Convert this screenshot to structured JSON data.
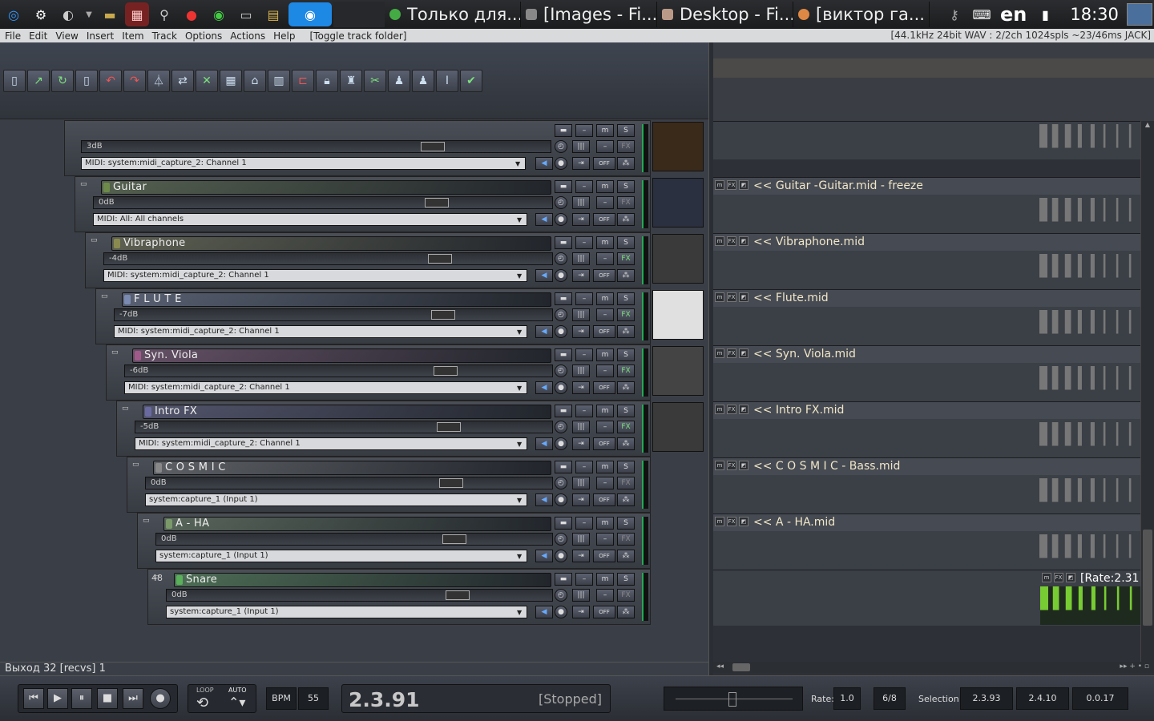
{
  "taskbar": {
    "tasks": [
      {
        "label": "Только для..."
      },
      {
        "label": "[Images - Fi..."
      },
      {
        "label": "Desktop - Fi..."
      },
      {
        "label": "[виктор га..."
      }
    ],
    "lang": "en",
    "clock": "18:30"
  },
  "menu": {
    "items": [
      "File",
      "Edit",
      "View",
      "Insert",
      "Item",
      "Track",
      "Options",
      "Actions",
      "Help"
    ],
    "extra": "[Toggle track folder]",
    "audio_info": "[44.1kHz 24bit WAV : 2/2ch 1024spls ~23/46ms JACK]"
  },
  "tracks": [
    {
      "name": "",
      "vol": "3dB",
      "input": "MIDI: system:midi_capture_2: Channel 1",
      "color": "#5a7a3a",
      "fx_on": false
    },
    {
      "name": "Guitar",
      "vol": "0dB",
      "input": "MIDI: All: All channels",
      "color": "#6e8a4a",
      "fx_on": false
    },
    {
      "name": "Vibraphone",
      "vol": "-4dB",
      "input": "MIDI: system:midi_capture_2: Channel 1",
      "color": "#8a8a50",
      "fx_on": true
    },
    {
      "name": "F L U T E",
      "vol": "-7dB",
      "input": "MIDI: system:midi_capture_2: Channel 1",
      "color": "#7a8ab0",
      "fx_on": true
    },
    {
      "name": "Syn. Viola",
      "vol": "-6dB",
      "input": "MIDI: system:midi_capture_2: Channel 1",
      "color": "#a05a8a",
      "fx_on": true
    },
    {
      "name": "Intro FX",
      "vol": "-5dB",
      "input": "MIDI: system:midi_capture_2: Channel 1",
      "color": "#6a6aa0",
      "fx_on": true
    },
    {
      "name": "C O S M I C",
      "vol": "0dB",
      "input": "system:capture_1 (Input 1)",
      "color": "#888888",
      "fx_on": false
    },
    {
      "name": "A - HA",
      "vol": "0dB",
      "input": "system:capture_1 (Input 1)",
      "color": "#7a9a6a",
      "fx_on": false
    },
    {
      "name": "Snare",
      "vol": "0dB",
      "input": "system:capture_1 (Input 1)",
      "color": "#5ab05a",
      "fx_on": false,
      "number": "48"
    }
  ],
  "clips": [
    {
      "label": ""
    },
    {
      "label": "<< Guitar -Guitar.mid - freeze"
    },
    {
      "label": "<< Vibraphone.mid"
    },
    {
      "label": "<< Flute.mid"
    },
    {
      "label": "<< Syn. Viola.mid"
    },
    {
      "label": "<< Intro FX.mid"
    },
    {
      "label": "<< C O S M I C - Bass.mid"
    },
    {
      "label": "<< A - HA.mid"
    },
    {
      "label": "[Rate:2.31"
    }
  ],
  "status": {
    "text": "Выход 32 [recvs] 1"
  },
  "transport": {
    "loop": "LOOP",
    "auto": "AUTO",
    "bpm_label": "BPM",
    "bpm": "55",
    "position": "2.3.91",
    "state": "[Stopped]",
    "rate_label": "Rate:",
    "rate": "1.0",
    "timesig": "6/8",
    "selection_label": "Selection:",
    "sel_start": "2.3.93",
    "sel_end": "2.4.10",
    "sel_len": "0.0.17"
  },
  "buttons": {
    "mute": "m",
    "solo": "S",
    "fx": "FX",
    "off": "OFF",
    "minus": "–"
  }
}
